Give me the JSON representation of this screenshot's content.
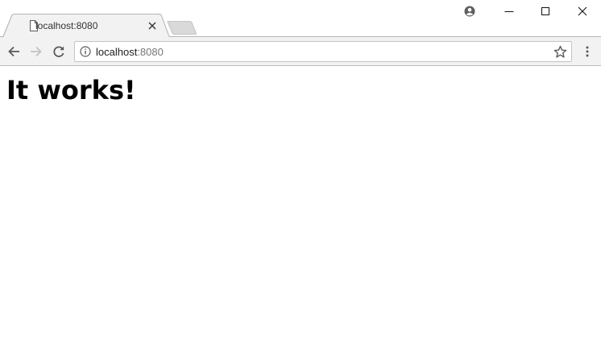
{
  "browser": {
    "tab": {
      "title": "localhost:8080",
      "favicon": "page-icon"
    },
    "new_tab": {
      "icon": "new-tab-icon"
    },
    "window_controls": {
      "profile_icon": "profile-icon",
      "minimize_icon": "minimize-icon",
      "maximize_icon": "maximize-icon",
      "close_icon": "close-icon"
    },
    "toolbar": {
      "back_icon": "back-arrow-icon",
      "forward_icon": "forward-arrow-icon",
      "reload_icon": "reload-icon",
      "menu_icon": "more-vertical-icon"
    },
    "address_bar": {
      "info_icon": "info-icon",
      "host": "localhost",
      "port": ":8080",
      "bookmark_icon": "star-icon"
    }
  },
  "page": {
    "heading": "It works!"
  },
  "colors": {
    "toolbar_bg": "#f2f2f2",
    "tab_bg": "#f2f2f2",
    "inactive_tab_bg": "#d9d9d9",
    "icon": "#5a5a5a",
    "icon_disabled": "#c2c2c2"
  }
}
